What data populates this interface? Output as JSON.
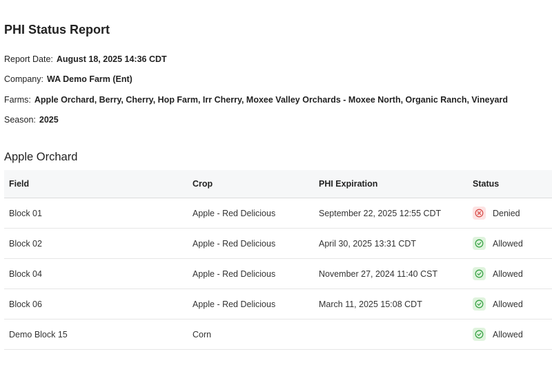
{
  "report": {
    "title": "PHI Status Report",
    "meta": [
      {
        "label": "Report Date:",
        "value": "August 18, 2025 14:36 CDT"
      },
      {
        "label": "Company:",
        "value": "WA Demo Farm (Ent)"
      },
      {
        "label": "Farms:",
        "value": "Apple Orchard, Berry, Cherry, Hop Farm, Irr Cherry, Moxee Valley Orchards - Moxee North, Organic Ranch, Vineyard"
      },
      {
        "label": "Season:",
        "value": "2025"
      }
    ]
  },
  "section": {
    "title": "Apple Orchard",
    "columns": [
      "Field",
      "Crop",
      "PHI Expiration",
      "Status"
    ],
    "rows": [
      {
        "field": "Block 01",
        "crop": "Apple - Red Delicious",
        "phi": "September 22, 2025 12:55 CDT",
        "status": "Denied",
        "status_icon": "x-circle-icon"
      },
      {
        "field": "Block 02",
        "crop": "Apple - Red Delicious",
        "phi": "April 30, 2025 13:31 CDT",
        "status": "Allowed",
        "status_icon": "check-circle-icon"
      },
      {
        "field": "Block 04",
        "crop": "Apple - Red Delicious",
        "phi": "November 27, 2024 11:40 CST",
        "status": "Allowed",
        "status_icon": "check-circle-icon"
      },
      {
        "field": "Block 06",
        "crop": "Apple - Red Delicious",
        "phi": "March 11, 2025 15:08 CDT",
        "status": "Allowed",
        "status_icon": "check-circle-icon"
      },
      {
        "field": "Demo Block 15",
        "crop": "Corn",
        "phi": "",
        "status": "Allowed",
        "status_icon": "check-circle-icon"
      }
    ]
  },
  "colors": {
    "denied_bg": "#fde3e3",
    "denied_fg": "#d9534f",
    "allowed_bg": "#dff3dd",
    "allowed_fg": "#3aa447",
    "header_bg": "#f6f7f8"
  }
}
